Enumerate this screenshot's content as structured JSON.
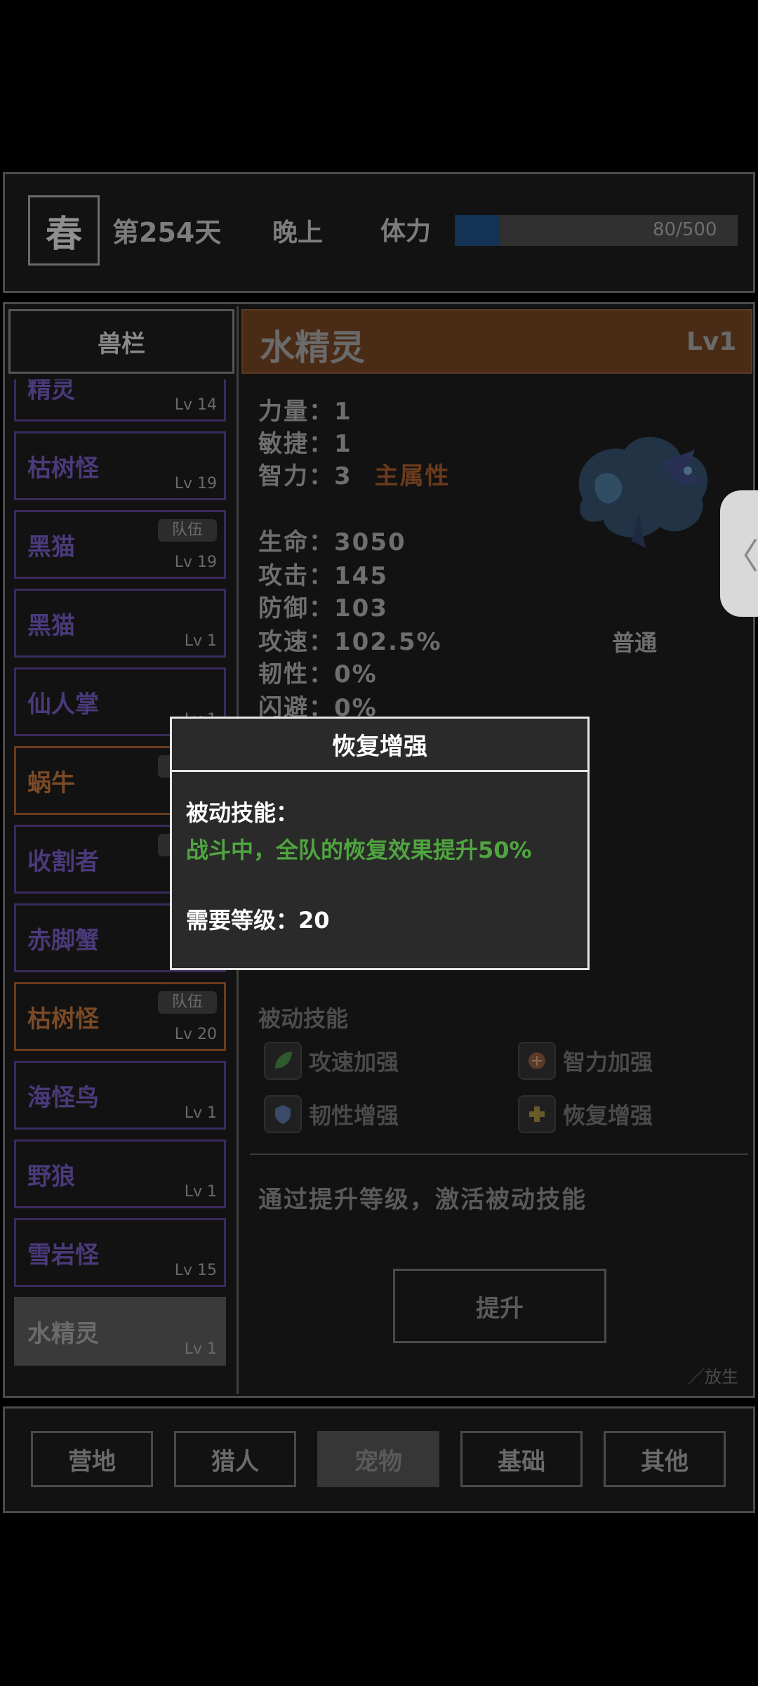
{
  "topbar": {
    "season": "春",
    "day": "第254天",
    "time_of_day": "晚上",
    "stamina_label": "体力",
    "stamina_text": "80/500",
    "stamina_fraction": 0.16
  },
  "sidebar": {
    "header": "兽栏",
    "items": [
      {
        "name": "精灵",
        "level": "Lv 14",
        "team": "",
        "style": "purple"
      },
      {
        "name": "枯树怪",
        "level": "Lv 19",
        "team": "",
        "style": "purple"
      },
      {
        "name": "黑猫",
        "level": "Lv 19",
        "team": "队伍",
        "style": "purple"
      },
      {
        "name": "黑猫",
        "level": "Lv 1",
        "team": "",
        "style": "purple"
      },
      {
        "name": "仙人掌",
        "level": "Lv 1",
        "team": "",
        "style": "purple"
      },
      {
        "name": "蜗牛",
        "level": "",
        "team": "队伍",
        "style": "orange"
      },
      {
        "name": "收割者",
        "level": "",
        "team": "队伍",
        "style": "purple"
      },
      {
        "name": "赤脚蟹",
        "level": "",
        "team": "",
        "style": "purple"
      },
      {
        "name": "枯树怪",
        "level": "Lv 20",
        "team": "队伍",
        "style": "orange"
      },
      {
        "name": "海怪鸟",
        "level": "Lv 1",
        "team": "",
        "style": "purple"
      },
      {
        "name": "野狼",
        "level": "Lv 1",
        "team": "",
        "style": "purple"
      },
      {
        "name": "雪岩怪",
        "level": "Lv 15",
        "team": "",
        "style": "purple"
      },
      {
        "name": "水精灵",
        "level": "Lv 1",
        "team": "",
        "style": "active"
      }
    ]
  },
  "detail": {
    "title": "水精灵",
    "level": "Lv1",
    "stats": {
      "strength": "力量：1",
      "agility": "敏捷：1",
      "intelligence": "智力：3",
      "main_attr": "主属性",
      "hp": "生命：3050",
      "attack": "攻击：145",
      "defense": "防御：103",
      "atk_speed": "攻速：102.5%",
      "toughness": "韧性：0%",
      "dodge": "闪避：0%"
    },
    "attack_type": "普通",
    "passive_title": "被动技能",
    "skills": [
      "攻速加强",
      "智力加强",
      "韧性增强",
      "恢复增强"
    ],
    "hint": "通过提升等级，激活被动技能",
    "upgrade_label": "提升",
    "release_label": "放生"
  },
  "side_tab": {
    "icon": "chevron-left-icon",
    "glyph": "〈"
  },
  "nav": [
    "营地",
    "猎人",
    "宠物",
    "基础",
    "其他"
  ],
  "popup": {
    "title": "恢复增强",
    "type_label": "被动技能：",
    "description": "战斗中，全队的恢复效果提升50%",
    "requirement": "需要等级：20"
  }
}
